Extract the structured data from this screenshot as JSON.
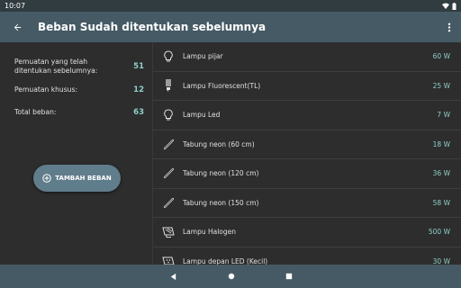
{
  "status": {
    "time": "10:07"
  },
  "app_bar": {
    "title": "Beban Sudah ditentukan sebelumnya"
  },
  "summary": {
    "preset_label": "Pemuatan yang telah ditentukan sebelumnya:",
    "preset_value": "51",
    "custom_label": "Pemuatan khusus:",
    "custom_value": "12",
    "total_label": "Total beban:",
    "total_value": "63"
  },
  "fab": {
    "label": "TAMBAH BEBAN"
  },
  "loads": [
    {
      "name": "Lampu pijar",
      "value": "60 W",
      "icon": "bulb-icon"
    },
    {
      "name": "Lampu Fluorescent(TL)",
      "value": "25 W",
      "icon": "fluorescent-lamp-icon"
    },
    {
      "name": "Lampu Led",
      "value": "7 W",
      "icon": "led-bulb-icon"
    },
    {
      "name": "Tabung neon (60 cm)",
      "value": "18 W",
      "icon": "neon-tube-icon"
    },
    {
      "name": "Tabung neon (120 cm)",
      "value": "36 W",
      "icon": "neon-tube-icon"
    },
    {
      "name": "Tabung neon (150 cm)",
      "value": "58 W",
      "icon": "neon-tube-icon"
    },
    {
      "name": "Lampu Halogen",
      "value": "500 W",
      "icon": "halogen-lamp-icon"
    },
    {
      "name": "Lampu depan LED (Kecil)",
      "value": "30 W",
      "icon": "led-floodlight-icon"
    }
  ],
  "colors": {
    "app_bar": "#455a64",
    "accent": "#8fcfc7",
    "background": "#2d2d2d",
    "fab": "#607d8b"
  }
}
